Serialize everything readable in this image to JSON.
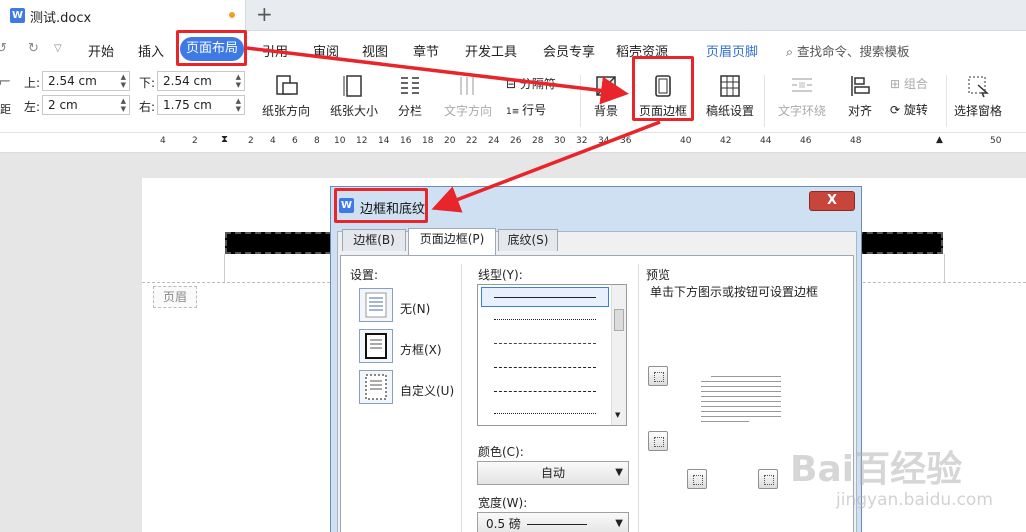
{
  "titlebar": {
    "doc_title": "测试.docx",
    "app_icon": "W",
    "new_tab_glyph": "+"
  },
  "menu": {
    "tabs": [
      "开始",
      "插入",
      "页面布局",
      "引用",
      "审阅",
      "视图",
      "章节",
      "开发工具",
      "会员专享",
      "稻壳资源",
      "页眉页脚"
    ],
    "active_tab": "页面布局",
    "search_placeholder": "查找命令、搜索模板"
  },
  "ribbon": {
    "margins": {
      "top_label": "上:",
      "top_value": "2.54 cm",
      "bottom_label": "下:",
      "bottom_value": "2.54 cm",
      "left_label": "左:",
      "left_value": "2 cm",
      "right_label": "右:",
      "right_value": "1.75 cm",
      "partial_label": "距"
    },
    "tools": {
      "orientation": "纸张方向",
      "size": "纸张大小",
      "columns": "分栏",
      "text_direction": "文字方向",
      "line_numbers": "行号",
      "section_break": "分隔符",
      "background": "背景",
      "page_border": "页面边框",
      "grid_paper": "稿纸设置",
      "text_wrap": "文字环绕",
      "align": "对齐",
      "group": "组合",
      "rotate": "旋转",
      "selection_pane": "选择窗格"
    }
  },
  "ruler": {
    "numbers": [
      "4",
      "2",
      "2",
      "4",
      "6",
      "8",
      "10",
      "12",
      "14",
      "16",
      "18",
      "20",
      "22",
      "24",
      "26",
      "28",
      "30",
      "32",
      "34",
      "36",
      "38",
      "40",
      "42",
      "44",
      "46",
      "48",
      "50"
    ]
  },
  "document": {
    "header_tag": "页眉"
  },
  "dialog": {
    "title": "边框和底纹",
    "close_glyph": "X",
    "tabs": [
      "边框(B)",
      "页面边框(P)",
      "底纹(S)"
    ],
    "active_tab": "页面边框(P)",
    "settings_label": "设置:",
    "settings": [
      "无(N)",
      "方框(X)",
      "自定义(U)"
    ],
    "line_style_label": "线型(Y):",
    "color_label": "颜色(C):",
    "color_value": "自动",
    "width_label": "宽度(W):",
    "width_value": "0.5 磅",
    "preview_label": "预览",
    "preview_hint": "单击下方图示或按钮可设置边框"
  },
  "watermark": {
    "main": "Bai百经验",
    "sub": "jingyan.baidu.com"
  },
  "colors": {
    "accent": "#3d7ae6",
    "highlight": "#e8252a",
    "close_red": "#c7453b",
    "dialog_frame": "#cfe0f3"
  }
}
